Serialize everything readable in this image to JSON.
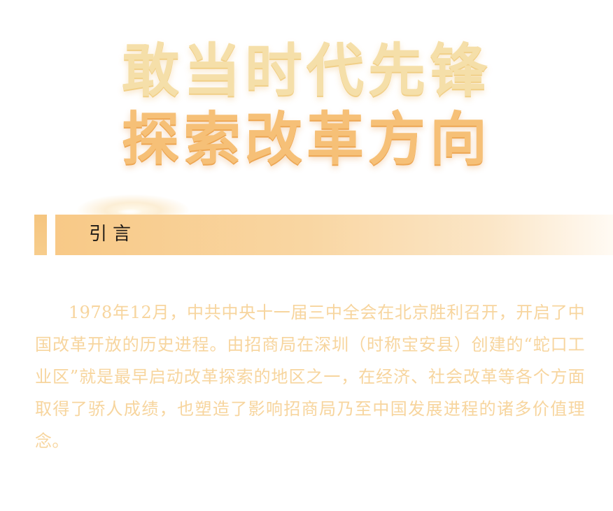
{
  "headline": {
    "line1": "敢当时代先锋",
    "line2": "探索改革方向"
  },
  "section": {
    "title": "引言"
  },
  "body": {
    "paragraph": "1978年12月，中共中央十一届三中全会在北京胜利召开，开启了中国改革开放的历史进程。由招商局在深圳（时称宝安县）创建的“蛇口工业区”就是最早启动改革探索的地区之一，在经济、社会改革等各个方面取得了骄人成绩，也塑造了影响招商局乃至中国发展进程的诸多价值理念。"
  },
  "colors": {
    "headline_line1": "#f5dfa9",
    "headline_line2": "#f6c077",
    "section_band": "#f8c987",
    "body_text": "#f7d59e",
    "section_title_text": "#1e1a16"
  }
}
